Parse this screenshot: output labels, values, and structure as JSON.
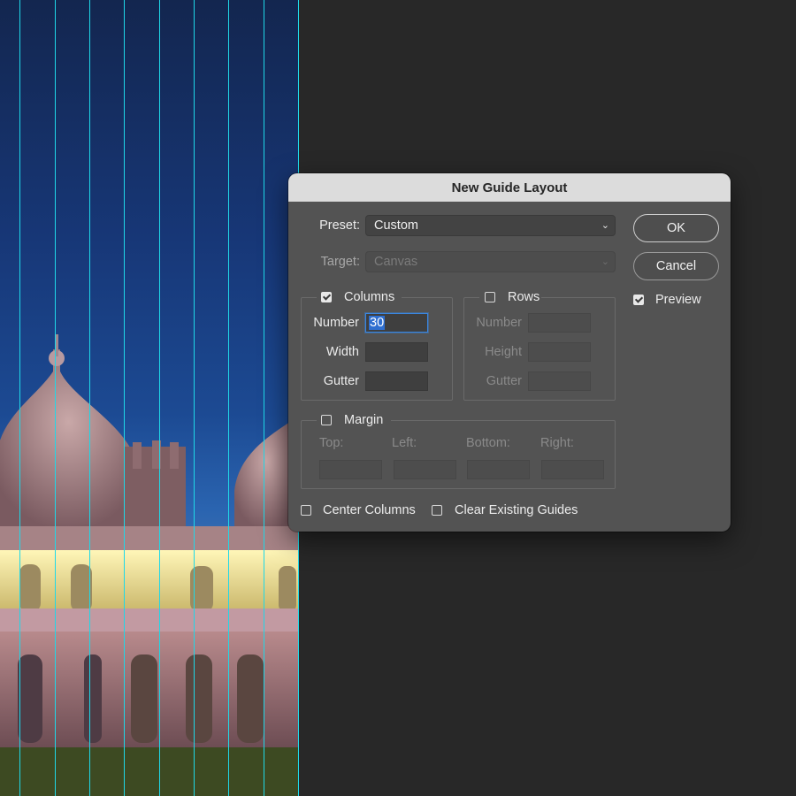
{
  "dialog": {
    "title": "New Guide Layout",
    "preset_label": "Preset:",
    "preset_value": "Custom",
    "target_label": "Target:",
    "target_value": "Canvas",
    "ok_label": "OK",
    "cancel_label": "Cancel",
    "preview_label": "Preview",
    "preview_checked": true,
    "columns": {
      "label": "Columns",
      "checked": true,
      "number_label": "Number",
      "number_value": "30",
      "width_label": "Width",
      "width_value": "",
      "gutter_label": "Gutter",
      "gutter_value": ""
    },
    "rows": {
      "label": "Rows",
      "checked": false,
      "number_label": "Number",
      "height_label": "Height",
      "gutter_label": "Gutter"
    },
    "margin": {
      "label": "Margin",
      "checked": false,
      "top_label": "Top:",
      "left_label": "Left:",
      "bottom_label": "Bottom:",
      "right_label": "Right:"
    },
    "center_columns_label": "Center Columns",
    "center_columns_checked": false,
    "clear_guides_label": "Clear Existing Guides",
    "clear_guides_checked": false
  },
  "colors": {
    "guide": "#1fd8e8",
    "dialog_bg": "#535353",
    "titlebar_bg": "#dcdcdc",
    "focus": "#3a86e0",
    "workspace": "#282828"
  },
  "icons": {
    "dropdown": "chevron-down-icon",
    "check": "checkmark-icon"
  }
}
